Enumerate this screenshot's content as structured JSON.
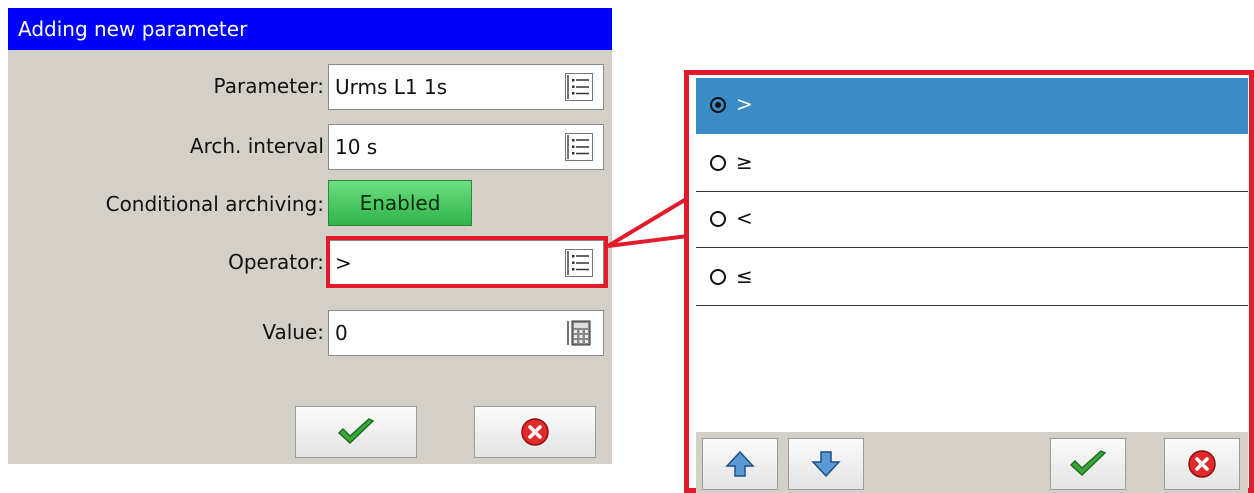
{
  "dialog": {
    "title": "Adding new parameter",
    "rows": {
      "parameter": {
        "label": "Parameter:",
        "value": "Urms L1 1s",
        "icon": "list-icon"
      },
      "arch_interval": {
        "label": "Arch. interval",
        "value": "10 s",
        "icon": "list-icon"
      },
      "conditional_archiving": {
        "label": "Conditional archiving:",
        "button": "Enabled"
      },
      "operator": {
        "label": "Operator:",
        "value": ">",
        "icon": "list-icon"
      },
      "value": {
        "label": "Value:",
        "value": "0",
        "icon": "calculator-icon"
      }
    },
    "buttons": {
      "ok_icon": "checkmark-icon",
      "cancel_icon": "cancel-icon"
    }
  },
  "operator_list": {
    "options": [
      {
        "label": ">",
        "selected": true
      },
      {
        "label": "≥",
        "selected": false
      },
      {
        "label": "<",
        "selected": false
      },
      {
        "label": "≤",
        "selected": false
      }
    ],
    "toolbar": [
      "up-arrow-icon",
      "down-arrow-icon",
      "checkmark-icon",
      "cancel-icon"
    ]
  },
  "colors": {
    "titlebar": "#0000ff",
    "highlight": "#e21b2c",
    "selected_row": "#3a8bc6",
    "enabled_button": "#2fb34a"
  }
}
